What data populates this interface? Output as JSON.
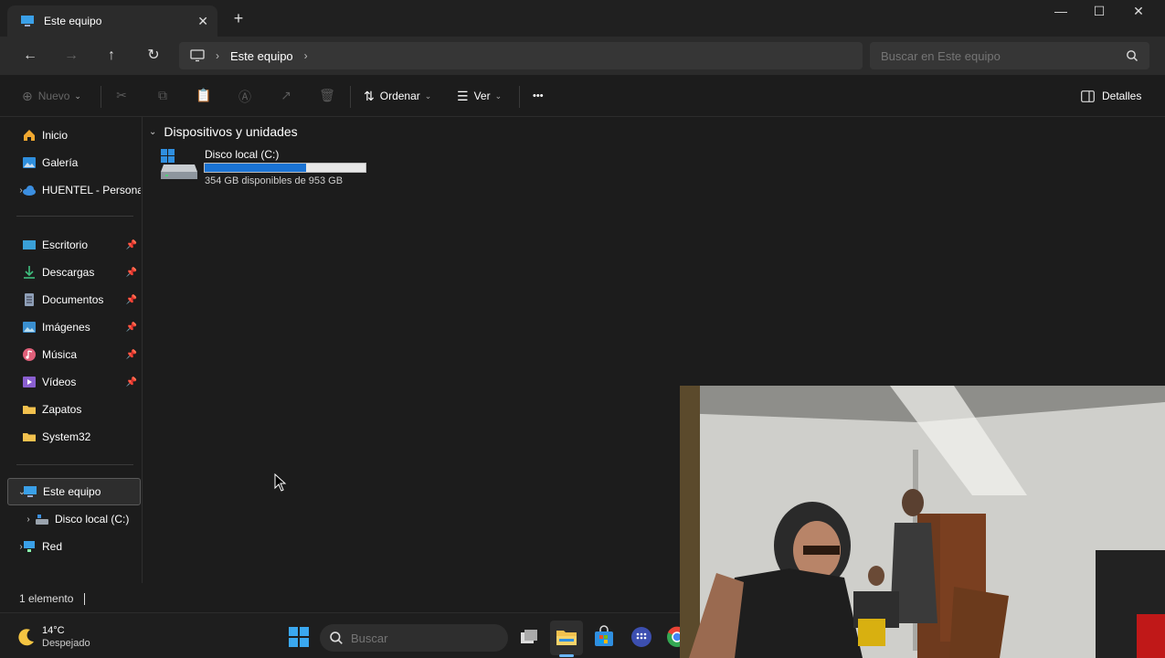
{
  "window": {
    "tab_title": "Este equipo",
    "tab_close": "✕",
    "new_tab": "+",
    "controls": {
      "minimize": "—",
      "maximize": "☐",
      "close": "✕"
    }
  },
  "nav": {
    "back": "←",
    "forward": "→",
    "up": "↑",
    "refresh": "↻",
    "breadcrumb": [
      "Este equipo"
    ],
    "search_placeholder": "Buscar en Este equipo"
  },
  "commands": {
    "new_label": "Nuevo",
    "sort_label": "Ordenar",
    "view_label": "Ver",
    "more": "•••",
    "details_label": "Detalles"
  },
  "sidebar": {
    "top_items": [
      {
        "label": "Inicio",
        "icon": "home-icon"
      },
      {
        "label": "Galería",
        "icon": "gallery-icon"
      },
      {
        "label": "HUENTEL - Personal",
        "icon": "onedrive-cloud-icon"
      }
    ],
    "quick_access": [
      {
        "label": "Escritorio",
        "icon": "desktop-icon",
        "pinned": true
      },
      {
        "label": "Descargas",
        "icon": "download-icon",
        "pinned": true
      },
      {
        "label": "Documentos",
        "icon": "document-icon",
        "pinned": true
      },
      {
        "label": "Imágenes",
        "icon": "pictures-icon",
        "pinned": true
      },
      {
        "label": "Música",
        "icon": "music-icon",
        "pinned": true
      },
      {
        "label": "Vídeos",
        "icon": "videos-icon",
        "pinned": true
      },
      {
        "label": "Zapatos",
        "icon": "folder-icon",
        "pinned": false
      },
      {
        "label": "System32",
        "icon": "folder-icon",
        "pinned": false
      }
    ],
    "tree": [
      {
        "label": "Este equipo",
        "icon": "computer-icon",
        "selected": true
      },
      {
        "label": "Disco local (C:)",
        "icon": "drive-icon"
      },
      {
        "label": "Red",
        "icon": "network-icon"
      }
    ]
  },
  "content": {
    "group_title": "Dispositivos y unidades",
    "drives": [
      {
        "name": "Disco local (C:)",
        "info": "354 GB disponibles de 953 GB",
        "used_fraction": 0.63
      }
    ]
  },
  "status": {
    "count": "1 elemento"
  },
  "taskbar": {
    "temp": "14°C",
    "weather": "Despejado",
    "search_placeholder": "Buscar"
  },
  "colors": {
    "accent": "#1a73d4",
    "window_bg": "#1c1c1c"
  }
}
